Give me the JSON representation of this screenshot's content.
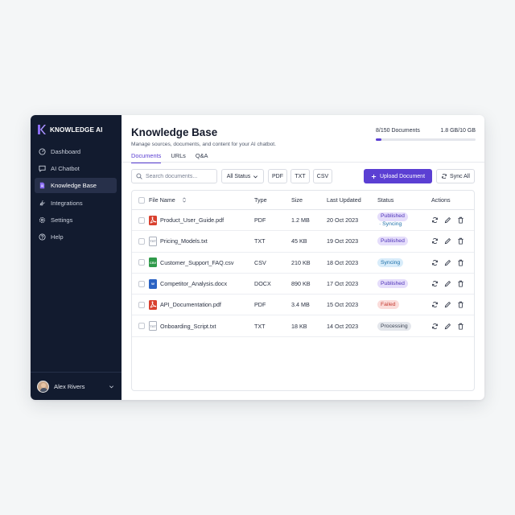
{
  "sidebar": {
    "brand": "KNOWLEDGE AI",
    "items": [
      {
        "label": "Dashboard",
        "icon": "dashboard-icon"
      },
      {
        "label": "AI Chatbot",
        "icon": "chat-icon"
      },
      {
        "label": "Knowledge Base",
        "icon": "document-icon",
        "active": true
      },
      {
        "label": "Integrations",
        "icon": "plug-icon"
      },
      {
        "label": "Settings",
        "icon": "gear-icon"
      },
      {
        "label": "Help",
        "icon": "help-icon"
      }
    ],
    "user": {
      "name": "Alex Rivers"
    }
  },
  "header": {
    "title": "Knowledge Base",
    "subtitle": "Manage sources, documents, and content for your AI chatbot.",
    "tabs": [
      {
        "label": "Documents",
        "active": true
      },
      {
        "label": "URLs"
      },
      {
        "label": "Q&A"
      }
    ]
  },
  "usage": {
    "documents_label": "8/150 Documents",
    "storage_label": "1.8 GB/10 GB",
    "fraction": 0.053
  },
  "toolbar": {
    "search_placeholder": "Search documents...",
    "status_filter": "All Status",
    "filters": [
      "PDF",
      "TXT",
      "CSV"
    ],
    "upload_label": "Upload Document",
    "sync_label": "Sync All"
  },
  "table": {
    "headers": {
      "name": "File Name",
      "type": "Type",
      "size": "Size",
      "updated": "Last Updated",
      "status": "Status",
      "actions": "Actions"
    },
    "rows": [
      {
        "name": "Product_User_Guide.pdf",
        "type": "PDF",
        "size": "1.2 MB",
        "updated": "20 Oct 2023",
        "status": "Published",
        "sub_status": "· Syncing"
      },
      {
        "name": "Pricing_Models.txt",
        "type": "TXT",
        "size": "45 KB",
        "updated": "19 Oct 2023",
        "status": "Published",
        "sub_status": ""
      },
      {
        "name": "Customer_Support_FAQ.csv",
        "type": "CSV",
        "size": "210 KB",
        "updated": "18 Oct 2023",
        "status": "Syncing",
        "sub_status": ""
      },
      {
        "name": "Competitor_Analysis.docx",
        "type": "DOCX",
        "size": "890 KB",
        "updated": "17 Oct 2023",
        "status": "Published",
        "sub_status": ""
      },
      {
        "name": "API_Documentation.pdf",
        "type": "PDF",
        "size": "3.4 MB",
        "updated": "15 Oct 2023",
        "status": "Failed",
        "sub_status": ""
      },
      {
        "name": "Onboarding_Script.txt",
        "type": "TXT",
        "size": "18 KB",
        "updated": "14 Oct 2023",
        "status": "Processing",
        "sub_status": ""
      }
    ]
  },
  "file_icons": {
    "PDF": {
      "glyph": "pdf-file-icon",
      "color": "#d9412f"
    },
    "TXT": {
      "glyph": "txt-file-icon",
      "color": "#8b93a3"
    },
    "CSV": {
      "glyph": "csv-file-icon",
      "color": "#2f9a4a"
    },
    "DOCX": {
      "glyph": "docx-file-icon",
      "color": "#2b63c4"
    }
  },
  "colors": {
    "accent": "#5b3fd3",
    "sidebar_bg": "#121b2f",
    "published": "#4d32b8",
    "syncing": "#1d6fa8",
    "failed": "#c43b31",
    "processing": "#3c4454"
  }
}
